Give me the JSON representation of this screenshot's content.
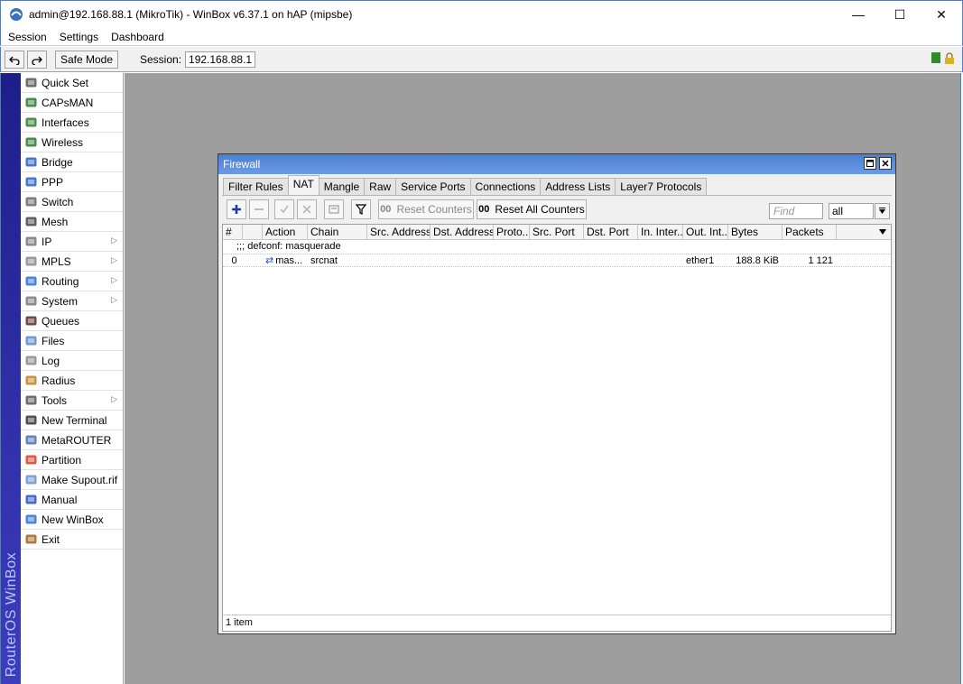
{
  "window": {
    "title": "admin@192.168.88.1 (MikroTik) - WinBox v6.37.1 on hAP (mipsbe)",
    "minimize": "—",
    "maximize": "☐",
    "close": "✕"
  },
  "menu": {
    "items": [
      "Session",
      "Settings",
      "Dashboard"
    ]
  },
  "toolbar": {
    "undo_icon": "undo-icon",
    "redo_icon": "redo-icon",
    "safe_mode_label": "Safe Mode",
    "session_label": "Session:",
    "session_value": "192.168.88.1"
  },
  "brand": {
    "vertical_text": "RouterOS WinBox"
  },
  "sidebar": {
    "items": [
      {
        "label": "Quick Set",
        "icon": "wand-icon",
        "submenu": false
      },
      {
        "label": "CAPsMAN",
        "icon": "antenna-icon",
        "submenu": false
      },
      {
        "label": "Interfaces",
        "icon": "interface-icon",
        "submenu": false
      },
      {
        "label": "Wireless",
        "icon": "antenna-icon",
        "submenu": false
      },
      {
        "label": "Bridge",
        "icon": "bridge-icon",
        "submenu": false
      },
      {
        "label": "PPP",
        "icon": "ppp-icon",
        "submenu": false
      },
      {
        "label": "Switch",
        "icon": "switch-icon",
        "submenu": false
      },
      {
        "label": "Mesh",
        "icon": "mesh-icon",
        "submenu": false
      },
      {
        "label": "IP",
        "icon": "ip-icon",
        "submenu": true
      },
      {
        "label": "MPLS",
        "icon": "mpls-icon",
        "submenu": true
      },
      {
        "label": "Routing",
        "icon": "routing-icon",
        "submenu": true
      },
      {
        "label": "System",
        "icon": "gear-icon",
        "submenu": true
      },
      {
        "label": "Queues",
        "icon": "queues-icon",
        "submenu": false
      },
      {
        "label": "Files",
        "icon": "folder-icon",
        "submenu": false
      },
      {
        "label": "Log",
        "icon": "log-icon",
        "submenu": false
      },
      {
        "label": "Radius",
        "icon": "radius-icon",
        "submenu": false
      },
      {
        "label": "Tools",
        "icon": "tools-icon",
        "submenu": true
      },
      {
        "label": "New Terminal",
        "icon": "terminal-icon",
        "submenu": false
      },
      {
        "label": "MetaROUTER",
        "icon": "metarouter-icon",
        "submenu": false
      },
      {
        "label": "Partition",
        "icon": "pie-icon",
        "submenu": false
      },
      {
        "label": "Make Supout.rif",
        "icon": "document-icon",
        "submenu": false
      },
      {
        "label": "Manual",
        "icon": "help-icon",
        "submenu": false
      },
      {
        "label": "New WinBox",
        "icon": "globe-icon",
        "submenu": false
      },
      {
        "label": "Exit",
        "icon": "exit-icon",
        "submenu": false
      }
    ]
  },
  "firewall": {
    "title": "Firewall",
    "tabs": [
      {
        "label": "Filter Rules",
        "active": false
      },
      {
        "label": "NAT",
        "active": true
      },
      {
        "label": "Mangle",
        "active": false
      },
      {
        "label": "Raw",
        "active": false
      },
      {
        "label": "Service Ports",
        "active": false
      },
      {
        "label": "Connections",
        "active": false
      },
      {
        "label": "Address Lists",
        "active": false
      },
      {
        "label": "Layer7 Protocols",
        "active": false
      }
    ],
    "actions": {
      "reset_counters": "Reset Counters",
      "reset_all_counters": "Reset All Counters",
      "counter_prefix": "00"
    },
    "find_placeholder": "Find",
    "filter_value": "all",
    "columns": [
      "#",
      "",
      "Action",
      "Chain",
      "Src. Address",
      "Dst. Address",
      "Proto...",
      "Src. Port",
      "Dst. Port",
      "In. Inter...",
      "Out. Int...",
      "Bytes",
      "Packets"
    ],
    "comment": ";;; defconf: masquerade",
    "rows": [
      {
        "num": "0",
        "flag": "",
        "action": "mas...",
        "chain": "srcnat",
        "src_address": "",
        "dst_address": "",
        "proto": "",
        "src_port": "",
        "dst_port": "",
        "in_interface": "",
        "out_interface": "ether1",
        "bytes": "188.8 KiB",
        "packets": "1 121"
      }
    ],
    "status": "1 item"
  }
}
